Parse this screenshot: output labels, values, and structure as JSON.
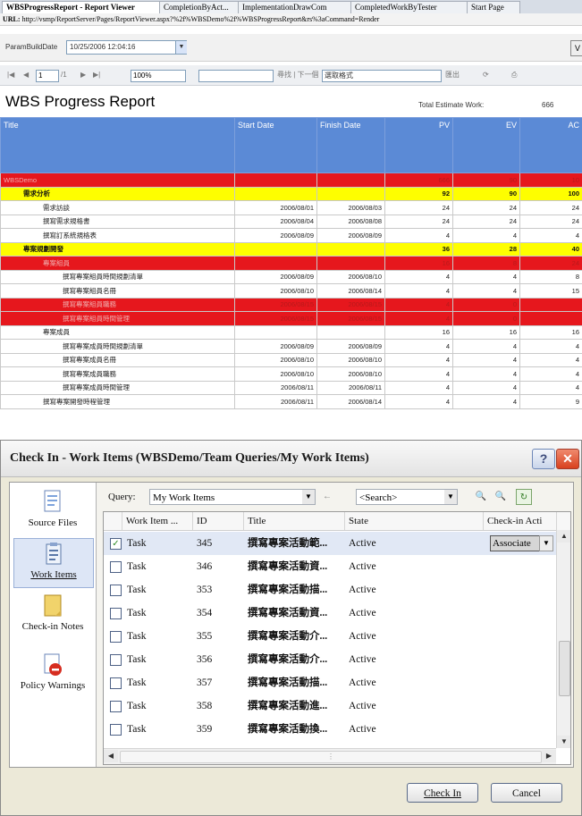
{
  "report_viewer": {
    "tabs": [
      "WBSProgressReport - Report Viewer",
      "CompletionByAct...",
      "ImplementationDrawCom",
      "CompletedWorkByTester",
      "Start Page"
    ],
    "url_label": "URL:",
    "url": "http://vsmp/ReportServer/Pages/ReportViewer.aspx?%2f%WBSDemo%2f%WBSProgressReport&rs%3aCommand=Render",
    "parameter_label": "ParamBuildDate",
    "parameter_value": "10/25/2006 12:04:16",
    "view_report_label": "V",
    "toolbar": {
      "first": "|◀",
      "prev": "◀",
      "page_value": "1",
      "of_pages": "/1",
      "next": "▶",
      "last": "▶|",
      "zoom": "100%",
      "find_label": "尋找 | 下一個",
      "export_format": "選取格式",
      "export_label": "匯出",
      "refresh_icon_label": "⟳",
      "print_icon_label": "⎙"
    },
    "report_title": "WBS Progress Report",
    "total_estimate_label": "Total Estimate Work:",
    "total_estimate_value": "666",
    "columns": [
      "Title",
      "Start Date",
      "Finish Date",
      "PV",
      "EV",
      "AC"
    ],
    "rows": [
      {
        "style": "red",
        "indent": 0,
        "title": "WBSDemo",
        "start": "",
        "finish": "",
        "pv": "666",
        "ev": "90",
        "ac": "10"
      },
      {
        "style": "yellow",
        "indent": 1,
        "title": "需求分析",
        "start": "",
        "finish": "",
        "pv": "92",
        "ev": "90",
        "ac": "100"
      },
      {
        "style": "white",
        "indent": 2,
        "title": "需求訪談",
        "start": "2006/08/01",
        "finish": "2006/08/03",
        "pv": "24",
        "ev": "24",
        "ac": "24"
      },
      {
        "style": "white",
        "indent": 2,
        "title": "撰寫需求規格書",
        "start": "2006/08/04",
        "finish": "2006/08/08",
        "pv": "24",
        "ev": "24",
        "ac": "24"
      },
      {
        "style": "white",
        "indent": 2,
        "title": "撰寫訂系統規格表",
        "start": "2006/08/09",
        "finish": "2006/08/09",
        "pv": "4",
        "ev": "4",
        "ac": "4"
      },
      {
        "style": "yellow",
        "indent": 1,
        "title": "專案規劃開發",
        "start": "",
        "finish": "",
        "pv": "36",
        "ev": "28",
        "ac": "40"
      },
      {
        "style": "red",
        "indent": 2,
        "title": "專案組員",
        "start": "",
        "finish": "",
        "pv": "16",
        "ev": "8",
        "ac": "24"
      },
      {
        "style": "white",
        "indent": 3,
        "title": "撰寫專案組員時間規劃清單",
        "start": "2006/08/09",
        "finish": "2006/08/10",
        "pv": "4",
        "ev": "4",
        "ac": "8"
      },
      {
        "style": "white",
        "indent": 3,
        "title": "撰寫專案組員名冊",
        "start": "2006/08/10",
        "finish": "2006/08/14",
        "pv": "4",
        "ev": "4",
        "ac": "15"
      },
      {
        "style": "red",
        "indent": 3,
        "title": "撰寫專案組員職務",
        "start": "2006/08/15",
        "finish": "2006/08/15",
        "pv": "4",
        "ev": "0",
        "ac": ""
      },
      {
        "style": "red",
        "indent": 3,
        "title": "撰寫專案組員時間管理",
        "start": "2006/08/15",
        "finish": "2006/08/15",
        "pv": "4",
        "ev": "0",
        "ac": ""
      },
      {
        "style": "white",
        "indent": 2,
        "title": "專案成員",
        "start": "",
        "finish": "",
        "pv": "16",
        "ev": "16",
        "ac": "16"
      },
      {
        "style": "white",
        "indent": 3,
        "title": "撰寫專案成員時間規劃清單",
        "start": "2006/08/09",
        "finish": "2006/08/09",
        "pv": "4",
        "ev": "4",
        "ac": "4"
      },
      {
        "style": "white",
        "indent": 3,
        "title": "撰寫專案成員名冊",
        "start": "2006/08/10",
        "finish": "2006/08/10",
        "pv": "4",
        "ev": "4",
        "ac": "4"
      },
      {
        "style": "white",
        "indent": 3,
        "title": "撰寫專案成員職務",
        "start": "2006/08/10",
        "finish": "2006/08/10",
        "pv": "4",
        "ev": "4",
        "ac": "4"
      },
      {
        "style": "white",
        "indent": 3,
        "title": "撰寫專案成員時間管理",
        "start": "2006/08/11",
        "finish": "2006/08/11",
        "pv": "4",
        "ev": "4",
        "ac": "4"
      },
      {
        "style": "white",
        "indent": 2,
        "title": "撰寫專案開發時程管理",
        "start": "2006/08/11",
        "finish": "2006/08/14",
        "pv": "4",
        "ev": "4",
        "ac": "9"
      }
    ]
  },
  "dialog": {
    "title": "Check In - Work Items (WBSDemo/Team Queries/My Work Items)",
    "help_label": "?",
    "close_label": "✕",
    "sidebar": [
      {
        "label": "Source Files",
        "icon": "source-files-icon"
      },
      {
        "label": "Work Items",
        "icon": "work-items-icon"
      },
      {
        "label": "Check-in Notes",
        "icon": "check-in-notes-icon"
      },
      {
        "label": "Policy Warnings",
        "icon": "policy-warnings-icon"
      }
    ],
    "query_label": "Query:",
    "query_value": "My Work Items",
    "search_placeholder": "<Search>",
    "columns": [
      "Work Item ...",
      "ID",
      "Title",
      "State",
      "Check-in Acti"
    ],
    "rows": [
      {
        "checked": true,
        "type": "Task",
        "id": "345",
        "title": "撰寫專案活動範...",
        "state": "Active",
        "action": "Associate"
      },
      {
        "checked": false,
        "type": "Task",
        "id": "346",
        "title": "撰寫專案活動資...",
        "state": "Active",
        "action": ""
      },
      {
        "checked": false,
        "type": "Task",
        "id": "353",
        "title": "撰寫專案活動描...",
        "state": "Active",
        "action": ""
      },
      {
        "checked": false,
        "type": "Task",
        "id": "354",
        "title": "撰寫專案活動資...",
        "state": "Active",
        "action": ""
      },
      {
        "checked": false,
        "type": "Task",
        "id": "355",
        "title": "撰寫專案活動介...",
        "state": "Active",
        "action": ""
      },
      {
        "checked": false,
        "type": "Task",
        "id": "356",
        "title": "撰寫專案活動介...",
        "state": "Active",
        "action": ""
      },
      {
        "checked": false,
        "type": "Task",
        "id": "357",
        "title": "撰寫專案活動描...",
        "state": "Active",
        "action": ""
      },
      {
        "checked": false,
        "type": "Task",
        "id": "358",
        "title": "撰寫專案活動進...",
        "state": "Active",
        "action": ""
      },
      {
        "checked": false,
        "type": "Task",
        "id": "359",
        "title": "撰寫專案活動換...",
        "state": "Active",
        "action": ""
      }
    ],
    "check_in_label": "Check In",
    "cancel_label": "Cancel"
  }
}
